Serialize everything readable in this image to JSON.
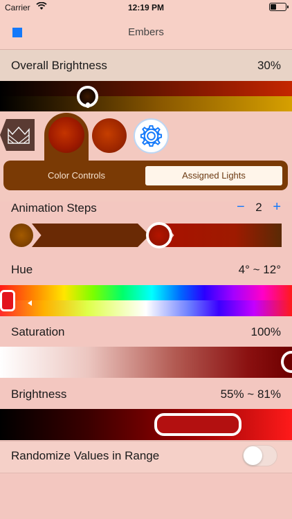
{
  "status_bar": {
    "carrier": "Carrier",
    "time": "12:19 PM"
  },
  "nav": {
    "title": "Embers"
  },
  "overall_brightness": {
    "label": "Overall Brightness",
    "value": "30%",
    "level": 0.3
  },
  "segmented": {
    "left_label": "Color Controls",
    "right_label": "Assigned Lights",
    "selected": "Assigned Lights"
  },
  "animation_steps": {
    "label": "Animation Steps",
    "minus": "−",
    "count": "2",
    "plus": "+"
  },
  "hue": {
    "label": "Hue",
    "value": "4° ~ 12°"
  },
  "saturation": {
    "label": "Saturation",
    "value": "100%"
  },
  "brightness": {
    "label": "Brightness",
    "value": "55% ~ 81%"
  },
  "randomize": {
    "label": "Randomize Values in Range",
    "on": false
  },
  "colors": {
    "accent": "#1479fa",
    "panel_brown": "#7a3a05",
    "background": "#f3c7c0"
  },
  "icons": {
    "stop": "stop-icon",
    "mode": "crown-pattern-icon",
    "settings": "gear-icon",
    "wifi": "wifi-icon",
    "battery": "battery-icon"
  }
}
